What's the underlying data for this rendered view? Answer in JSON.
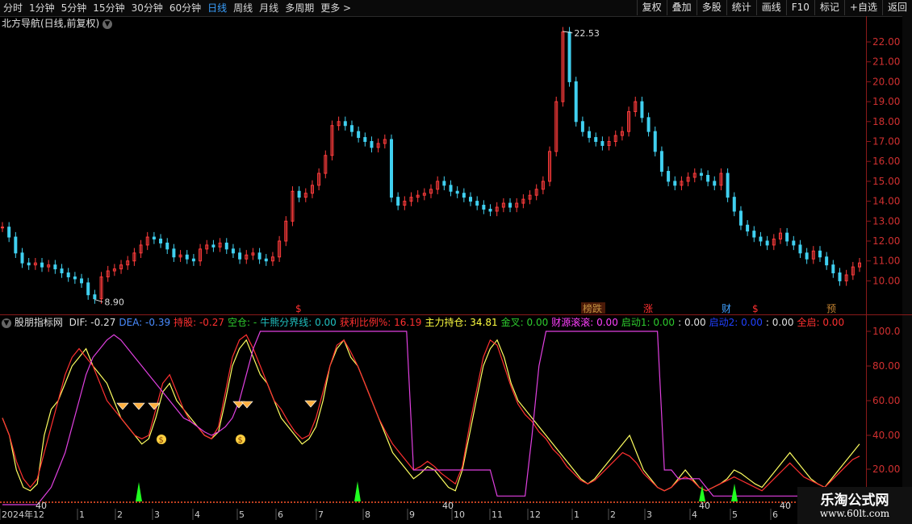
{
  "tabs": [
    "分时",
    "1分钟",
    "5分钟",
    "15分钟",
    "30分钟",
    "60分钟",
    "日线",
    "周线",
    "月线",
    "多周期",
    "更多 >"
  ],
  "active_tab": "日线",
  "tools": [
    "复权",
    "叠加",
    "多股",
    "统计",
    "画线",
    "F10",
    "标记",
    "+自选",
    "返回"
  ],
  "main_title": "北方导航(日线,前复权)",
  "price_axis": [
    "22.00",
    "21.00",
    "20.00",
    "19.00",
    "18.00",
    "17.00",
    "16.00",
    "15.00",
    "14.00",
    "13.00",
    "12.00",
    "11.00",
    "10.00"
  ],
  "ind_axis": [
    "100.0",
    "80.00",
    "60.00",
    "40.00",
    "20.00"
  ],
  "high_label": "22.53",
  "low_label": "8.90",
  "markers": [
    "$",
    "榜跌",
    "涨",
    "财",
    "$",
    "预"
  ],
  "indicator_name": "股朋指标网",
  "ind_items": [
    {
      "label": "DIF:",
      "value": "-0.27",
      "lc": "#e0e0e0",
      "vc": "#e0e0e0"
    },
    {
      "label": "DEA:",
      "value": "-0.39",
      "lc": "#4a8cff",
      "vc": "#4a8cff"
    },
    {
      "label": "持股:",
      "value": "-0.27",
      "lc": "#ff3030",
      "vc": "#ff3030"
    },
    {
      "label": "空仓:",
      "value": "-",
      "lc": "#2ecc2e",
      "vc": "#2ecc2e"
    },
    {
      "label": "牛熊分界线:",
      "value": "0.00",
      "lc": "#20c0c0",
      "vc": "#20c0c0"
    },
    {
      "label": "获利比例%:",
      "value": "16.19",
      "lc": "#ff3030",
      "vc": "#ff3030"
    },
    {
      "label": "主力持仓:",
      "value": "34.81",
      "lc": "#ffff40",
      "vc": "#ffff40"
    },
    {
      "label": "金叉:",
      "value": "0.00",
      "lc": "#2ecc2e",
      "vc": "#2ecc2e"
    },
    {
      "label": "财源滚滚:",
      "value": "0.00",
      "lc": "#ff40ff",
      "vc": "#ff40ff"
    },
    {
      "label": "启动1:",
      "value": "0.00",
      "lc": "#2ecc2e",
      "vc": "#2ecc2e"
    },
    {
      "label": ":",
      "value": "0.00",
      "lc": "#e0e0e0",
      "vc": "#e0e0e0"
    },
    {
      "label": "启动2:",
      "value": "0.00",
      "lc": "#2040ff",
      "vc": "#2040ff"
    },
    {
      "label": ":",
      "value": "0.00",
      "lc": "#e0e0e0",
      "vc": "#e0e0e0"
    },
    {
      "label": "全启:",
      "value": "0.00",
      "lc": "#ff3030",
      "vc": "#ff3030"
    }
  ],
  "small_labels": [
    "40",
    "40",
    "40",
    "40"
  ],
  "dates": [
    "2024年12",
    "1",
    "2",
    "3",
    "4",
    "5",
    "6",
    "7",
    "8",
    "9",
    "10",
    "11",
    "12",
    "1",
    "2",
    "3",
    "4",
    "5",
    "6"
  ],
  "watermark_title": "乐淘公式网",
  "watermark_url": "www.60lt.com",
  "colors": {
    "up": "#ff3c3c",
    "down": "#40d0f0",
    "axis": "#8b1a1a",
    "magenta": "#e040e0",
    "yellow": "#ffff60",
    "green": "#20ff20"
  },
  "chart_data": [
    {
      "type": "candlestick",
      "series": [
        {
          "name": "北方导航",
          "values_close": [
            12.7,
            12.2,
            11.4,
            10.9,
            10.8,
            10.9,
            10.7,
            10.8,
            10.6,
            10.4,
            10.2,
            10.1,
            9.9,
            9.3,
            9.1,
            10.2,
            10.5,
            10.6,
            10.8,
            11.0,
            11.4,
            11.8,
            12.2,
            12.1,
            11.9,
            11.6,
            11.2,
            11.3,
            11.1,
            11.0,
            11.6,
            11.8,
            11.7,
            11.9,
            11.6,
            11.4,
            11.1,
            11.3,
            11.4,
            11.1,
            11.0,
            11.2,
            12.0,
            13.0,
            14.5,
            14.2,
            14.4,
            14.8,
            15.4,
            16.3,
            17.8,
            18.0,
            17.8,
            17.5,
            17.2,
            17.0,
            16.7,
            16.9,
            17.1,
            14.2,
            13.8,
            14.0,
            14.2,
            14.3,
            14.4,
            14.6,
            15.0,
            14.8,
            14.5,
            14.4,
            14.2,
            14.0,
            13.8,
            13.6,
            13.5,
            13.7,
            13.9,
            13.7,
            13.9,
            14.1,
            14.3,
            14.6,
            15.0,
            16.5,
            19.0,
            22.5,
            20.0,
            18.0,
            17.5,
            17.2,
            17.0,
            16.8,
            17.0,
            17.3,
            17.5,
            18.5,
            19.0,
            18.2,
            17.5,
            16.5,
            15.5,
            15.0,
            14.8,
            15.0,
            15.2,
            15.4,
            15.3,
            15.0,
            14.8,
            15.4,
            14.2,
            13.5,
            12.8,
            12.5,
            12.2,
            12.0,
            11.8,
            12.1,
            12.4,
            12.0,
            11.8,
            11.4,
            11.1,
            11.5,
            11.2,
            10.8,
            10.4,
            10.0,
            10.3,
            10.7,
            10.9
          ]
        }
      ],
      "ylim": [
        9.5,
        22.8
      ]
    },
    {
      "type": "line",
      "series": [
        {
          "name": "主力持仓",
          "values": [
            50,
            40,
            20,
            10,
            8,
            12,
            40,
            55,
            60,
            70,
            80,
            85,
            90,
            80,
            75,
            70,
            60,
            50,
            45,
            40,
            35,
            38,
            50,
            65,
            70,
            60,
            55,
            50,
            45,
            40,
            38,
            42,
            60,
            80,
            90,
            95,
            85,
            75,
            70,
            60,
            50,
            45,
            40,
            35,
            38,
            45,
            60,
            80,
            90,
            95,
            85,
            80,
            70,
            60,
            50,
            40,
            30,
            25,
            20,
            15,
            18,
            22,
            20,
            15,
            10,
            8,
            20,
            40,
            60,
            80,
            90,
            95,
            85,
            70,
            60,
            55,
            50,
            45,
            40,
            35,
            30,
            25,
            20,
            15,
            12,
            15,
            20,
            25,
            30,
            35,
            40,
            30,
            20,
            15,
            10,
            8,
            10,
            15,
            20,
            15,
            10,
            8,
            10,
            12,
            15,
            20,
            18,
            15,
            12,
            10,
            15,
            20,
            25,
            30,
            25,
            20,
            15,
            12,
            10,
            15,
            20,
            25,
            30,
            35
          ]
        },
        {
          "name": "获利比例%",
          "values": [
            50,
            40,
            25,
            15,
            10,
            15,
            30,
            45,
            60,
            75,
            85,
            90,
            85,
            80,
            70,
            60,
            55,
            50,
            45,
            40,
            38,
            40,
            55,
            70,
            75,
            65,
            55,
            48,
            45,
            40,
            38,
            45,
            65,
            85,
            95,
            98,
            90,
            80,
            70,
            60,
            55,
            48,
            42,
            38,
            40,
            50,
            65,
            80,
            92,
            95,
            88,
            80,
            70,
            60,
            50,
            42,
            35,
            30,
            25,
            20,
            22,
            25,
            22,
            18,
            15,
            12,
            22,
            45,
            65,
            85,
            95,
            92,
            80,
            68,
            58,
            52,
            48,
            42,
            38,
            32,
            28,
            22,
            18,
            14,
            12,
            14,
            18,
            22,
            26,
            30,
            28,
            24,
            18,
            14,
            10,
            8,
            10,
            14,
            16,
            14,
            10,
            8,
            10,
            12,
            14,
            16,
            14,
            12,
            10,
            8,
            12,
            16,
            20,
            24,
            20,
            16,
            14,
            12,
            10,
            14,
            18,
            22,
            26,
            28
          ]
        },
        {
          "name": "财源滚滚",
          "values": [
            0,
            0,
            0,
            0,
            0,
            0,
            5,
            10,
            20,
            30,
            45,
            60,
            75,
            85,
            90,
            95,
            98,
            95,
            90,
            85,
            80,
            75,
            70,
            65,
            60,
            55,
            50,
            48,
            45,
            42,
            40,
            42,
            45,
            50,
            60,
            75,
            90,
            100,
            100,
            100,
            100,
            100,
            100,
            100,
            100,
            100,
            100,
            100,
            100,
            100,
            100,
            100,
            100,
            100,
            100,
            100,
            100,
            100,
            100,
            20,
            20,
            20,
            20,
            20,
            20,
            20,
            20,
            20,
            20,
            20,
            20,
            5,
            5,
            5,
            5,
            5,
            40,
            80,
            100,
            100,
            100,
            100,
            100,
            100,
            100,
            100,
            100,
            100,
            100,
            100,
            100,
            100,
            100,
            100,
            100,
            20,
            20,
            15,
            15,
            15,
            15,
            10,
            5,
            5,
            5,
            5,
            5,
            5,
            5,
            5,
            5,
            5,
            5,
            5,
            5,
            5,
            5,
            5,
            5,
            5,
            5,
            5,
            5,
            5
          ]
        }
      ],
      "ylim": [
        0,
        105
      ]
    }
  ]
}
